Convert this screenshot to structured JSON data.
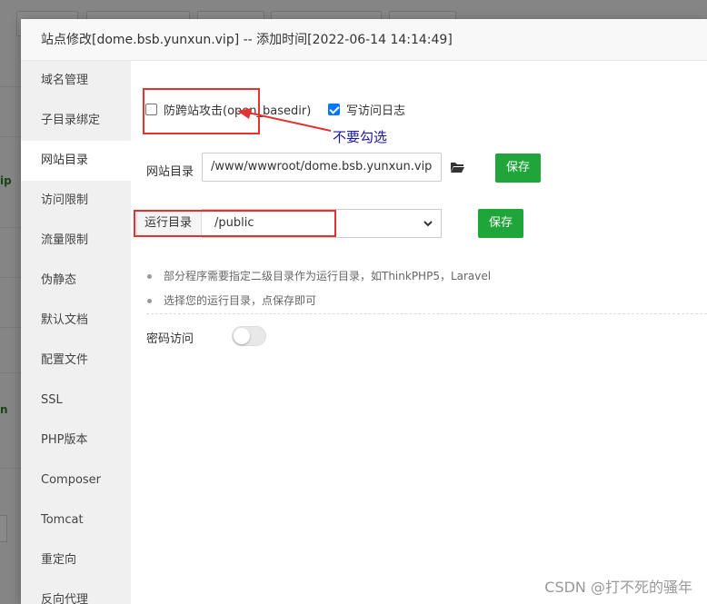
{
  "modal": {
    "title": "站点修改[dome.bsb.yunxun.vip] -- 添加时间[2022-06-14 14:14:49]"
  },
  "sidebar": {
    "items": [
      {
        "label": "域名管理"
      },
      {
        "label": "子目录绑定"
      },
      {
        "label": "网站目录"
      },
      {
        "label": "访问限制"
      },
      {
        "label": "流量限制"
      },
      {
        "label": "伪静态"
      },
      {
        "label": "默认文档"
      },
      {
        "label": "配置文件"
      },
      {
        "label": "SSL"
      },
      {
        "label": "PHP版本"
      },
      {
        "label": "Composer"
      },
      {
        "label": "Tomcat"
      },
      {
        "label": "重定向"
      },
      {
        "label": "反向代理"
      }
    ],
    "active_index": 2
  },
  "options": {
    "anti_xss_label": "防跨站攻击(open_basedir)",
    "anti_xss_checked": false,
    "access_log_label": "写访问日志",
    "access_log_checked": true
  },
  "annotation": {
    "hint": "不要勾选",
    "color": "#e43131"
  },
  "site_dir": {
    "label": "网站目录",
    "value": "/www/wwwroot/dome.bsb.yunxun.vip",
    "save_label": "保存"
  },
  "run_dir": {
    "label": "运行目录",
    "value": "/public",
    "save_label": "保存"
  },
  "notes": [
    "部分程序需要指定二级目录作为运行目录，如ThinkPHP5，Laravel",
    "选择您的运行目录，点保存即可"
  ],
  "password_access": {
    "label": "密码访问",
    "enabled": false
  },
  "background": {
    "side_text_1": "ip",
    "side_text_2": "n"
  },
  "watermark": "CSDN @打不死的骚年",
  "colors": {
    "primary_green": "#20a53a",
    "checkbox_blue": "#0075ff",
    "hint_blue": "#1a1aa0"
  }
}
